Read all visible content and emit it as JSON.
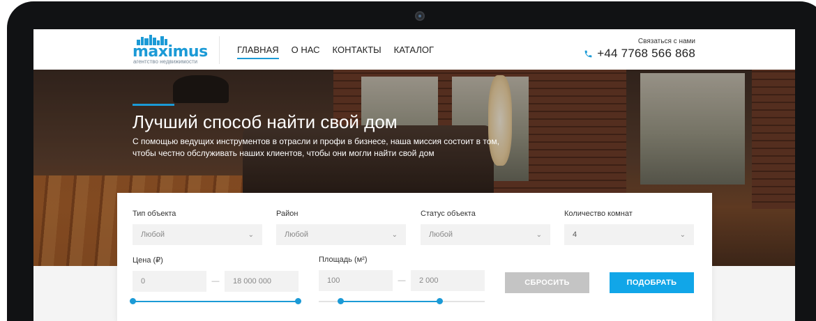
{
  "brand": {
    "logo_word": "maximus",
    "tagline": "агентство недвижимости"
  },
  "nav": {
    "items": [
      {
        "label": "ГЛАВНАЯ",
        "active": true
      },
      {
        "label": "О НАС",
        "active": false
      },
      {
        "label": "КОНТАКТЫ",
        "active": false
      },
      {
        "label": "КАТАЛОГ",
        "active": false
      }
    ]
  },
  "contact": {
    "label": "Связаться с нами",
    "phone": "+44 7768 566 868",
    "icon": "phone-icon"
  },
  "hero": {
    "title": "Лучший способ найти свой дом",
    "subtitle_line1": "С помощью ведущих инструментов в отрасли и профи в бизнесе, наша миссия состоит в том,",
    "subtitle_line2": "чтобы честно обслуживать наших клиентов, чтобы они могли найти свой дом"
  },
  "search": {
    "fields": [
      {
        "label": "Тип объекта",
        "value": "Любой"
      },
      {
        "label": "Район",
        "value": "Любой"
      },
      {
        "label": "Статус объекта",
        "value": "Любой"
      },
      {
        "label": "Количество комнат",
        "value": "4"
      }
    ],
    "price": {
      "label": "Цена (₽)",
      "min": "0",
      "max": "18 000 000",
      "range_fraction": [
        0.0,
        1.0
      ]
    },
    "area": {
      "label": "Площадь (м²)",
      "min": "100",
      "max": "2 000",
      "range_fraction": [
        0.13,
        0.73
      ]
    },
    "dash": "—",
    "reset_label": "СБРОСИТЬ",
    "submit_label": "ПОДОБРАТЬ"
  },
  "colors": {
    "accent": "#1b9ad6",
    "submit": "#11a6e8",
    "reset": "#c4c4c4"
  }
}
